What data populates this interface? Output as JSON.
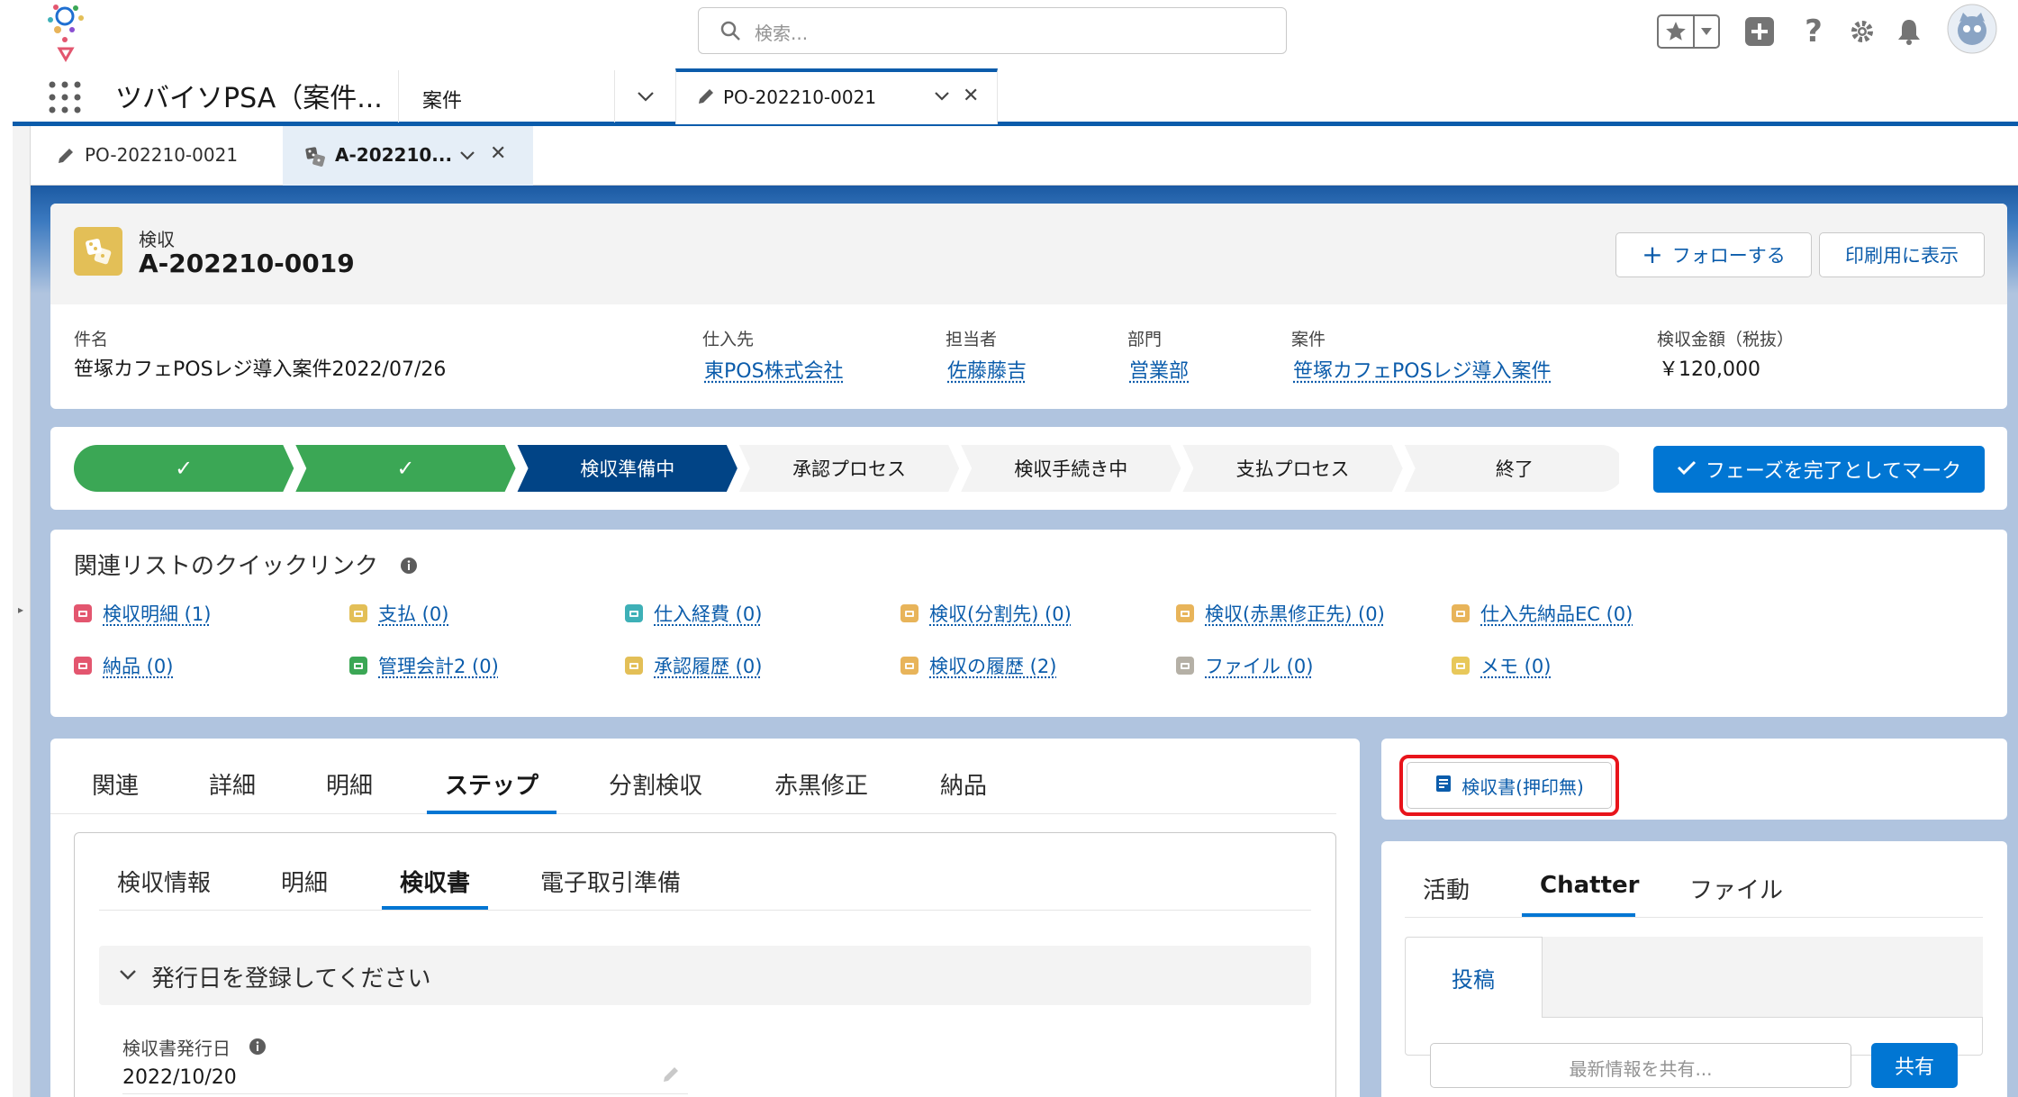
{
  "header": {
    "search_placeholder": "検索..."
  },
  "nav": {
    "app_name": "ツバイソPSA（案件...",
    "item_anken": "案件",
    "active_tab": "PO-202210-0021"
  },
  "subtabs": [
    {
      "label": "PO-202210-0021"
    },
    {
      "label": "A-202210..."
    }
  ],
  "record": {
    "type": "検収",
    "name": "A-202210-0019",
    "follow_label": "フォローする",
    "print_label": "印刷用に表示",
    "fields": {
      "subject_label": "件名",
      "subject_value": "笹塚カフェPOSレジ導入案件2022/07/26",
      "supplier_label": "仕入先",
      "supplier_value": "東POS株式会社",
      "owner_label": "担当者",
      "owner_value": "佐藤藤吉",
      "dept_label": "部門",
      "dept_value": "営業部",
      "project_label": "案件",
      "project_value": "笹塚カフェPOSレジ導入案件",
      "amount_label": "検収金額（税抜）",
      "amount_value": "￥120,000"
    }
  },
  "path": {
    "stages": [
      {
        "label": "✓",
        "state": "complete"
      },
      {
        "label": "✓",
        "state": "complete"
      },
      {
        "label": "検収準備中",
        "state": "current"
      },
      {
        "label": "承認プロセス",
        "state": "incomplete"
      },
      {
        "label": "検収手続き中",
        "state": "incomplete"
      },
      {
        "label": "支払プロセス",
        "state": "incomplete"
      },
      {
        "label": "終了",
        "state": "incomplete"
      }
    ],
    "mark_complete_label": "フェーズを完了としてマーク",
    "colors": {
      "complete": "#3ba755",
      "current": "#014486",
      "incomplete": "#f3f3f3"
    }
  },
  "quicklinks": {
    "title": "関連リストのクイックリンク",
    "items": [
      {
        "label": "検収明細 (1)",
        "color": "#e3566f"
      },
      {
        "label": "支払 (0)",
        "color": "#e3bf57"
      },
      {
        "label": "仕入経費 (0)",
        "color": "#3eb0b7"
      },
      {
        "label": "検収(分割先) (0)",
        "color": "#e8b45a"
      },
      {
        "label": "検収(赤黒修正先) (0)",
        "color": "#e8b45a"
      },
      {
        "label": "仕入先納品EC (0)",
        "color": "#e8b45a"
      },
      {
        "label": "納品 (0)",
        "color": "#e3566f"
      },
      {
        "label": "管理会計2 (0)",
        "color": "#3ba755"
      },
      {
        "label": "承認履歴 (0)",
        "color": "#e3bf57"
      },
      {
        "label": "検収の履歴 (2)",
        "color": "#e8b45a"
      },
      {
        "label": "ファイル (0)",
        "color": "#b5b0a6"
      },
      {
        "label": "メモ (0)",
        "color": "#e8c85a"
      }
    ]
  },
  "main_tabs": [
    "関連",
    "詳細",
    "明細",
    "ステップ",
    "分割検収",
    "赤黒修正",
    "納品"
  ],
  "inner_tabs": [
    "検収情報",
    "明細",
    "検収書",
    "電子取引準備"
  ],
  "section": {
    "title": "発行日を登録してください",
    "issue_date_label": "検収書発行日",
    "issue_date_value": "2022/10/20"
  },
  "actions": {
    "receipt_button": "検収書(押印無)"
  },
  "activity_tabs": [
    "活動",
    "Chatter",
    "ファイル"
  ],
  "chatter": {
    "post_tab": "投稿",
    "share_placeholder": "最新情報を共有...",
    "share_button": "共有"
  }
}
